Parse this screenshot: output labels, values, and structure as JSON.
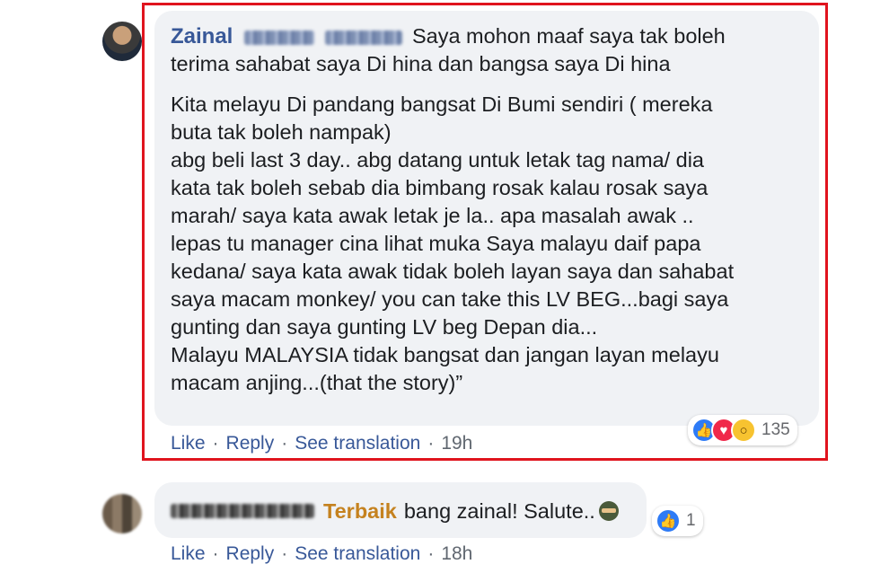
{
  "comment1": {
    "author_first": "Zainal",
    "lead_text": "Saya mohon maaf saya tak boleh",
    "para1_line2": "terima sahabat saya Di hina dan bangsa saya Di hina",
    "para2_lines": [
      "Kita melayu Di pandang bangsat Di Bumi sendiri ( mereka",
      "buta tak boleh nampak)",
      "abg beli last 3 day.. abg datang untuk letak tag nama/ dia",
      "kata tak boleh sebab dia bimbang rosak kalau rosak saya",
      "marah/ saya kata awak letak je la.. apa masalah awak ..",
      "lepas tu manager cina lihat muka Saya malayu daif papa",
      "kedana/ saya kata awak tidak boleh layan saya dan sahabat",
      "saya macam monkey/ you can take this LV BEG...bagi saya",
      "gunting dan saya gunting LV beg Depan dia...",
      "Malayu MALAYSIA tidak bangsat dan jangan layan melayu",
      "macam anjing...(that the story)”"
    ],
    "reaction_count": "135",
    "actions": {
      "like": "Like",
      "reply": "Reply",
      "translate": "See translation",
      "time": "19h"
    }
  },
  "comment2": {
    "badge_name": "Terbaik",
    "text": "bang zainal! Salute..",
    "reaction_count": "1",
    "actions": {
      "like": "Like",
      "reply": "Reply",
      "translate": "See translation",
      "time": "18h"
    }
  },
  "colors": {
    "highlight": "#e0141e",
    "link": "#385898",
    "bubble": "#f0f2f5",
    "badge": "#c5821f"
  }
}
